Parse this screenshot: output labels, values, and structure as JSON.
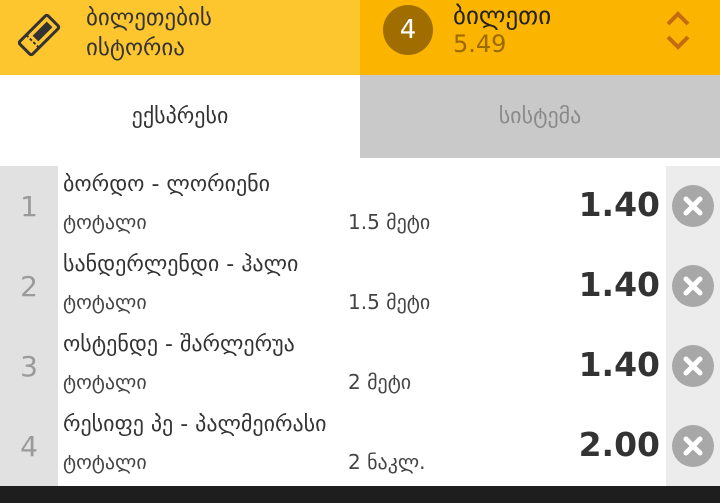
{
  "header": {
    "history": {
      "label": "ბილეთების\nისტორია",
      "icon": "ticket-icon"
    },
    "bet": {
      "count": "4",
      "title": "ბილეთი",
      "odds": "5.49"
    }
  },
  "tabs": [
    {
      "label": "ექსპრესი",
      "active": true
    },
    {
      "label": "სისტემა",
      "active": false
    }
  ],
  "bets": [
    {
      "number": "1",
      "match": "ბორდო - ლორიენი",
      "market": "ტოტალი",
      "line": "1.5 მეტი",
      "odds": "1.40"
    },
    {
      "number": "2",
      "match": "სანდერლენდი - ჰალი",
      "market": "ტოტალი",
      "line": "1.5 მეტი",
      "odds": "1.40"
    },
    {
      "number": "3",
      "match": "ოსტენდე - შარლერუა",
      "market": "ტოტალი",
      "line": "2 მეტი",
      "odds": "1.40"
    },
    {
      "number": "4",
      "match": "რესიფე პე - პალმეირასი",
      "market": "ტოტალი",
      "line": "2 ნაკლ.",
      "odds": "2.00"
    }
  ],
  "colors": {
    "history_bg": "#fdc52e",
    "bet_bg": "#fbb400",
    "badge_bg": "#a06e00",
    "remove_icon": "#a8a8a8"
  }
}
